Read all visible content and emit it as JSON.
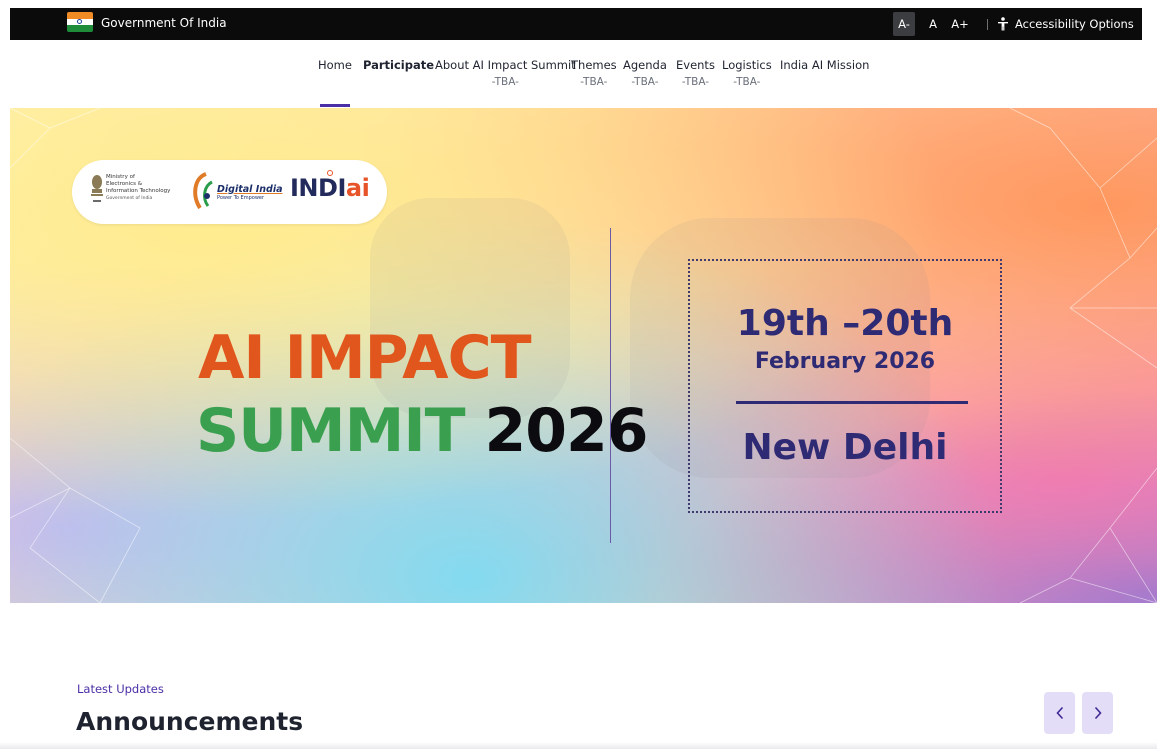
{
  "gov_bar": {
    "title": "Government Of India",
    "font_decrease": "A-",
    "font_normal": "A",
    "font_increase": "A+",
    "accessibility_label": "Accessibility Options",
    "flag_colors": [
      "#f08a24",
      "#ffffff",
      "#1e8c3a"
    ]
  },
  "nav": {
    "items": [
      {
        "label": "Home",
        "sub": ""
      },
      {
        "label": "Participate",
        "sub": ""
      },
      {
        "label": "About AI Impact Summit",
        "sub": "-TBA-"
      },
      {
        "label": "Themes",
        "sub": "-TBA-"
      },
      {
        "label": "Agenda",
        "sub": "-TBA-"
      },
      {
        "label": "Events",
        "sub": "-TBA-"
      },
      {
        "label": "Logistics",
        "sub": "-TBA-"
      },
      {
        "label": "India AI Mission",
        "sub": ""
      }
    ],
    "active": "Home",
    "accent_color": "#4b2fa6"
  },
  "hero": {
    "logos": {
      "meity_line1": "Ministry of",
      "meity_line2": "Electronics &",
      "meity_line3": "Information Technology",
      "meity_line4": "Government of India",
      "digital_india": "Digital India",
      "digital_india_tagline": "Power To Empower",
      "indiai_part1": "INDI",
      "indiai_part2": "ai"
    },
    "title_line1": "AI IMPACT",
    "title_word2": "SUMMIT",
    "title_year": "2026",
    "date_range": "19th –20th",
    "date_month_year": "February 2026",
    "city": "New Delhi",
    "colors": {
      "impact": "#e0561c",
      "summit": "#3aa04f",
      "date_text": "#2e2a73"
    }
  },
  "announcements": {
    "eyebrow": "Latest Updates",
    "title": "Announcements",
    "prev_icon": "chevron-left-icon",
    "next_icon": "chevron-right-icon"
  }
}
